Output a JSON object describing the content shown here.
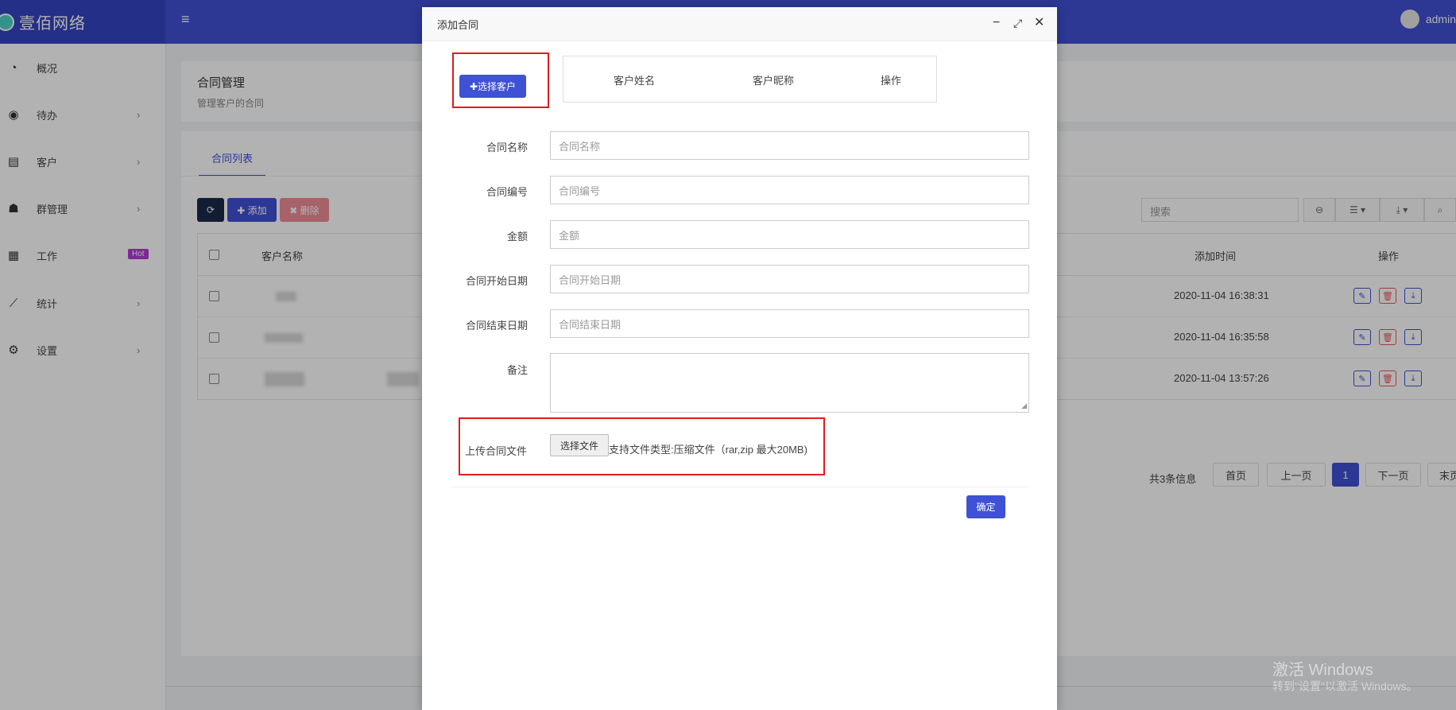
{
  "app": {
    "title": "壹佰网络",
    "user": "admin"
  },
  "sidebar": {
    "items": [
      {
        "label": "概况",
        "icon": "dashboard-icon",
        "glyph": "◔",
        "chevron": ""
      },
      {
        "label": "待办",
        "icon": "compass-icon",
        "glyph": "◉",
        "chevron": "›"
      },
      {
        "label": "客户",
        "icon": "id-card-icon",
        "glyph": "▤",
        "chevron": "›"
      },
      {
        "label": "群管理",
        "icon": "users-icon",
        "glyph": "☗",
        "chevron": "›"
      },
      {
        "label": "工作",
        "icon": "grid-icon",
        "glyph": "▦",
        "chevron": "",
        "badge": "Hot"
      },
      {
        "label": "统计",
        "icon": "line-chart-icon",
        "glyph": "⟋",
        "chevron": "›"
      },
      {
        "label": "设置",
        "icon": "gear-icon",
        "glyph": "⚙",
        "chevron": "›"
      }
    ]
  },
  "header": {
    "title": "合同管理",
    "subtitle": "管理客户的合同"
  },
  "list": {
    "tab": "合同列表",
    "toolbar": {
      "refresh": "⟳",
      "add": "✚ 添加",
      "delete": "✖ 删除"
    },
    "search_placeholder": "搜索",
    "columns": [
      "客户名称",
      "添加时间",
      "操作"
    ],
    "rows": [
      {
        "time": "2020-11-04 16:38:31"
      },
      {
        "time": "2020-11-04 16:35:58"
      },
      {
        "time": "2020-11-04 13:57:26"
      }
    ],
    "pager": {
      "info": "共3条信息",
      "first": "首页",
      "prev": "上一页",
      "current": "1",
      "next": "下一页",
      "last": "末页"
    }
  },
  "modal": {
    "title": "添加合同",
    "select_customer": "✚选择客户",
    "customer_columns": [
      "客户姓名",
      "客户昵称",
      "操作"
    ],
    "fields": [
      {
        "label": "合同名称",
        "placeholder": "合同名称"
      },
      {
        "label": "合同编号",
        "placeholder": "合同编号"
      },
      {
        "label": "金额",
        "placeholder": "金额"
      },
      {
        "label": "合同开始日期",
        "placeholder": "合同开始日期"
      },
      {
        "label": "合同结束日期",
        "placeholder": "合同结束日期"
      }
    ],
    "remark_label": "备注",
    "upload_label": "上传合同文件",
    "file_button": "选择文件",
    "file_hint": "支持文件类型:压缩文件（rar,zip 最大20MB)",
    "confirm": "确定"
  },
  "watermark": {
    "line1": "激活 Windows",
    "line2": "转到\"设置\"以激活 Windows。"
  }
}
